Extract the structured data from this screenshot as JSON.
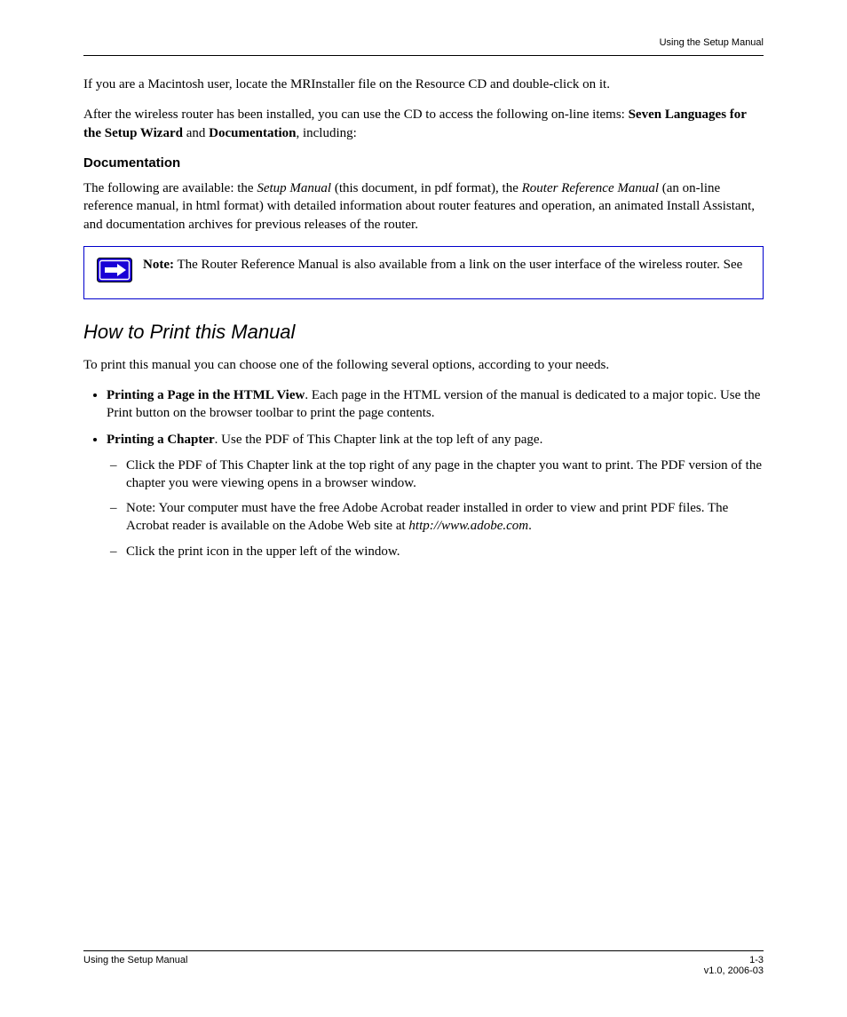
{
  "header": {
    "right": "Using the Setup Manual"
  },
  "intro": {
    "p1": "If you are a Macintosh user, locate the MRInstaller file on the Resource CD and double-click on it.",
    "p2_prefix": "After the wireless router has been installed, you can use the CD to access the following on-line items: ",
    "p2_bold_a": "Seven Languages for the Setup Wizard",
    "p2_mid": " and ",
    "p2_bold_b": "Documentation",
    "p2_suffix": ", including:"
  },
  "docs": {
    "title": "Documentation",
    "p_prefix": "The following are available: the ",
    "p_italic_a": "Setup Manual",
    "p_mid": " (this document, in pdf format), the ",
    "p_italic_b": "Router Reference Manual",
    "p_suffix": " (an on-line reference manual, in html format) with detailed information about router features and operation, an animated Install Assistant, and documentation archives for previous releases of the router."
  },
  "note": {
    "label": "Note:",
    "text": "The Router Reference Manual is also available from a link on the user interface of the wireless router. See"
  },
  "section": {
    "title": "How to Print this Manual",
    "intro": "To print this manual you can choose one of the following several options, according to your needs.",
    "bullets": [
      {
        "bold": "Printing a Page in the HTML View",
        "rest": ". Each page in the HTML version of the manual is dedicated to a major topic. Use the Print button on the browser toolbar to print the page contents."
      },
      {
        "bold": "Printing a Chapter",
        "rest": ". Use the PDF of This Chapter link at the top left of any page.",
        "sub": [
          "Click the PDF of This Chapter link at the top right of any page in the chapter you want to print. The PDF version of the chapter you were viewing opens in a browser window.",
          {
            "prefix": "Note: Your computer must have the free Adobe Acrobat reader installed in order to view and print PDF files. The Acrobat reader is available on the Adobe Web site at ",
            "link": "http://www.adobe.com",
            "suffix": "."
          },
          "Click the print icon in the upper left of the window."
        ]
      }
    ]
  },
  "footer": {
    "left": "Using the Setup Manual",
    "right_line1": "1-3",
    "right_line2": "v1.0, 2006-03"
  }
}
